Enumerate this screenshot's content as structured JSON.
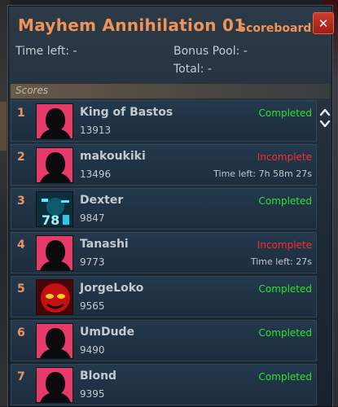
{
  "window": {
    "title": "Mayhem Annihilation 01",
    "subtitle": "Scoreboard",
    "close_label": "✕"
  },
  "info": {
    "time_left": "Time left: -",
    "bonus_pool": "Bonus Pool: -",
    "total": "Total: -"
  },
  "scores_header": "Scores",
  "colors": {
    "accent": "#f0935a",
    "completed": "#2de32d",
    "incomplete": "#ff2a2a"
  },
  "rows": [
    {
      "rank": "1",
      "name": "King of Bastos",
      "score": "13913",
      "status": "Completed",
      "state": "ok",
      "time_left": "",
      "avatar": "silhouette"
    },
    {
      "rank": "2",
      "name": "makoukiki",
      "score": "13496",
      "status": "Incomplete",
      "state": "bad",
      "time_left": "Time left: 7h 58m 27s",
      "avatar": "silhouette"
    },
    {
      "rank": "3",
      "name": "Dexter",
      "score": "9847",
      "status": "Completed",
      "state": "ok",
      "time_left": "",
      "avatar": "tech"
    },
    {
      "rank": "4",
      "name": "Tanashi",
      "score": "9773",
      "status": "Incomplete",
      "state": "bad",
      "time_left": "Time left: 27s",
      "avatar": "silhouette"
    },
    {
      "rank": "5",
      "name": "JorgeLoko",
      "score": "9565",
      "status": "Completed",
      "state": "ok",
      "time_left": "",
      "avatar": "red"
    },
    {
      "rank": "6",
      "name": "UmDude",
      "score": "9490",
      "status": "Completed",
      "state": "ok",
      "time_left": "",
      "avatar": "silhouette"
    },
    {
      "rank": "7",
      "name": "Blond",
      "score": "9395",
      "status": "Completed",
      "state": "ok",
      "time_left": "",
      "avatar": "silhouette"
    }
  ]
}
